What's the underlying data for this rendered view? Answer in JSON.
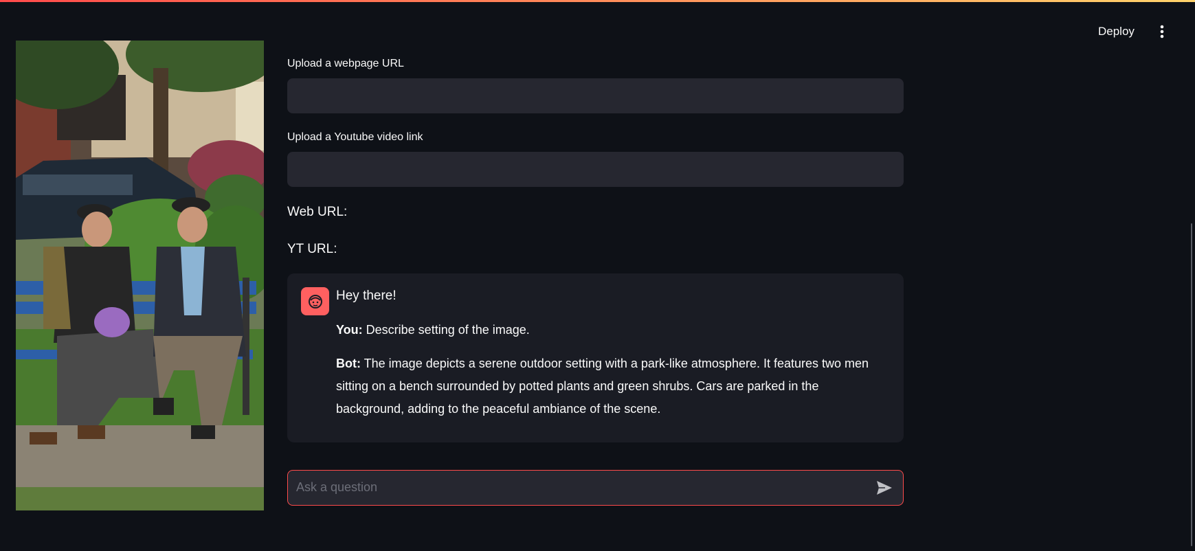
{
  "header": {
    "deploy_label": "Deploy",
    "menu_icon": "kebab-menu-icon"
  },
  "image_panel": {
    "description_icon": "photo"
  },
  "form": {
    "webpage_label": "Upload a webpage URL",
    "webpage_value": "",
    "youtube_label": "Upload a Youtube video link",
    "youtube_value": "",
    "web_url_text": "Web URL:",
    "yt_url_text": "YT URL:"
  },
  "chat": {
    "avatar_icon": "bot-face-icon",
    "greeting": "Hey there!",
    "messages": [
      {
        "speaker": "You:",
        "text": " Describe setting of the image."
      },
      {
        "speaker": "Bot:",
        "text": " The image depicts a serene outdoor setting with a park-like atmosphere. It features two men sitting on a bench surrounded by potted plants and green shrubs. Cars are parked in the background, adding to the peaceful ambiance of the scene."
      }
    ]
  },
  "ask": {
    "placeholder": "Ask a question",
    "send_icon": "send-icon"
  },
  "colors": {
    "background": "#0e1117",
    "input_bg": "#262730",
    "card_bg": "#1a1c24",
    "accent": "#ff4b4b",
    "avatar": "#ff6060"
  }
}
